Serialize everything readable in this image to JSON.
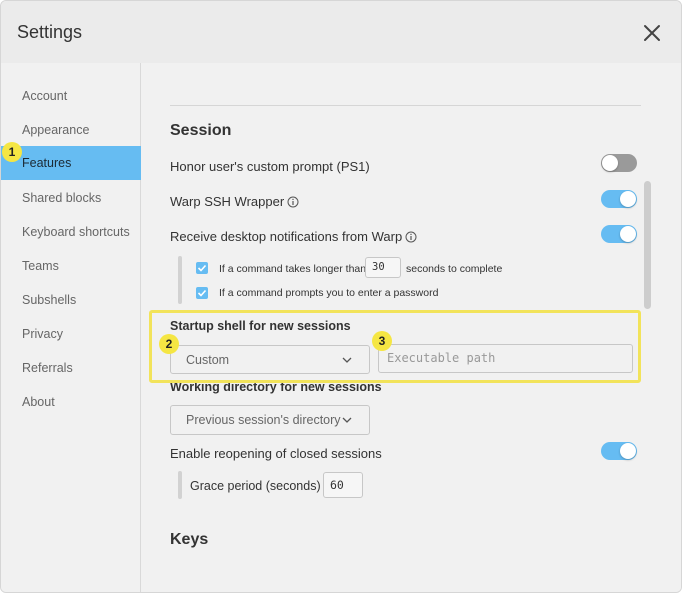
{
  "header": {
    "title": "Settings"
  },
  "sidebar": {
    "items": [
      {
        "label": "Account"
      },
      {
        "label": "Appearance"
      },
      {
        "label": "Features"
      },
      {
        "label": "Shared blocks"
      },
      {
        "label": "Keyboard shortcuts"
      },
      {
        "label": "Teams"
      },
      {
        "label": "Subshells"
      },
      {
        "label": "Privacy"
      },
      {
        "label": "Referrals"
      },
      {
        "label": "About"
      }
    ],
    "active": "Features"
  },
  "session": {
    "title": "Session",
    "honor_ps1": {
      "label": "Honor user's custom prompt (PS1)",
      "enabled": false
    },
    "ssh_wrapper": {
      "label": "Warp SSH Wrapper",
      "enabled": true
    },
    "notifications": {
      "label": "Receive desktop notifications from Warp",
      "enabled": true,
      "long_command": {
        "prefix": "If a command takes longer than",
        "value": "30",
        "suffix": "seconds to complete",
        "checked": true
      },
      "password_prompt": {
        "label": "If a command prompts you to enter a password",
        "checked": true
      }
    },
    "startup_shell": {
      "label": "Startup shell for new sessions",
      "selected": "Custom",
      "path_placeholder": "Executable path"
    },
    "working_dir": {
      "label": "Working directory for new sessions",
      "selected": "Previous session's directory"
    },
    "reopen": {
      "label": "Enable reopening of closed sessions",
      "enabled": true,
      "grace_label": "Grace period (seconds)",
      "grace_value": "60"
    }
  },
  "keys": {
    "title": "Keys"
  },
  "annotations": [
    "1",
    "2",
    "3"
  ],
  "colors": {
    "accent": "#66bcf2",
    "highlight": "#f2e35a",
    "badge": "#f5e643"
  }
}
